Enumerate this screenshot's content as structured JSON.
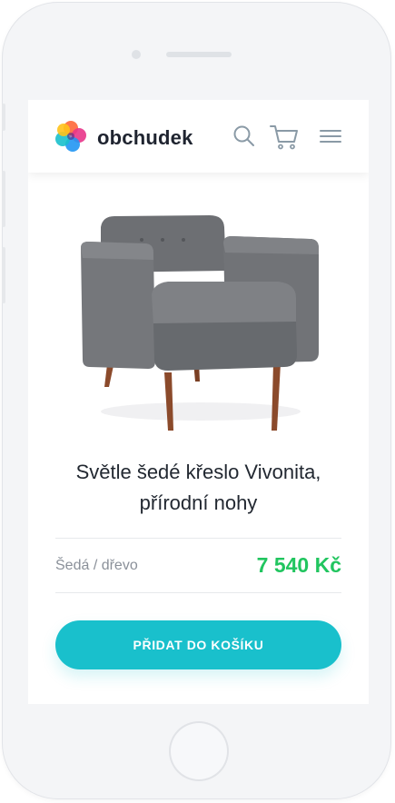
{
  "header": {
    "brand": "obchudek",
    "icons": [
      "logo-icon",
      "search-icon",
      "cart-icon",
      "menu-icon"
    ]
  },
  "product": {
    "title_line1": "Světle šedé křeslo Vivonita,",
    "title_line2": "přírodní nohy",
    "variant": "Šedá / dřevo",
    "price": "7 540 Kč"
  },
  "cta": {
    "label": "PŘIDAT DO KOŠÍKU"
  },
  "colors": {
    "accent": "#19c0cc",
    "price": "#21c55f",
    "text": "#222831",
    "muted": "#8a9099"
  }
}
